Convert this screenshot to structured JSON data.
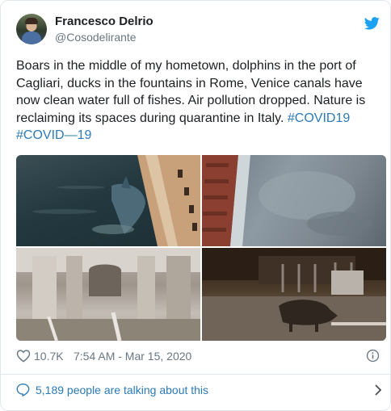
{
  "author": {
    "name": "Francesco Delrio",
    "handle": "@Cosodelirante"
  },
  "tweet": {
    "text_body": "Boars in the middle of my hometown, dolphins in the port of Cagliari, ducks in the fountains in Rome, Venice canals have now clean water full of fishes. Air pollution dropped. Nature is reclaiming its spaces during quarantine in Italy. ",
    "hashtag_1": "#COVID19",
    "hashtag_2": "#COVID—19"
  },
  "media": {
    "images": [
      {
        "name": "dolphin-in-port-photo"
      },
      {
        "name": "canal-water-photo"
      },
      {
        "name": "fountain-photo"
      },
      {
        "name": "boar-in-street-photo"
      }
    ]
  },
  "meta": {
    "likes": "10.7K",
    "timestamp": "7:54 AM - Mar 15, 2020"
  },
  "footer": {
    "talking": "5,189 people are talking about this"
  },
  "colors": {
    "link": "#2b7bb9",
    "twitter_blue": "#1da1f2",
    "secondary_text": "#697882",
    "border": "#e1e8ed"
  },
  "icons": [
    "twitter-bird-icon",
    "heart-icon",
    "info-icon",
    "speech-bubble-icon",
    "chevron-right-icon"
  ]
}
